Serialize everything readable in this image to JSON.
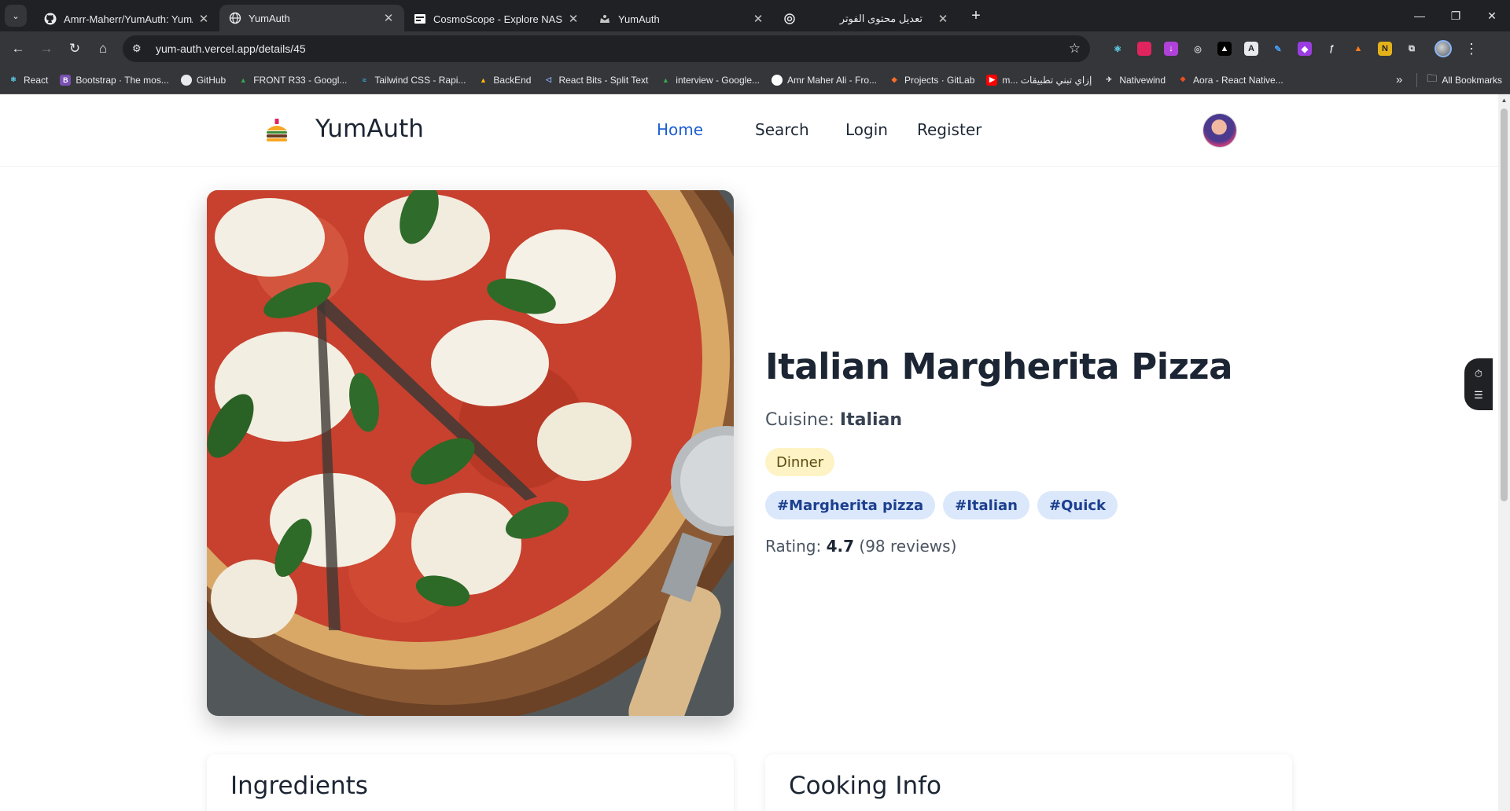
{
  "browser": {
    "tabs": [
      {
        "title": "Amrr-Maherr/YumAuth: YumAuth",
        "icon": "github-icon",
        "active": false
      },
      {
        "title": "YumAuth",
        "icon": "globe-icon",
        "active": true
      },
      {
        "title": "CosmoScope - Explore NASA's",
        "icon": "cosmoscope-icon",
        "active": false
      },
      {
        "title": "YumAuth",
        "icon": "chef-hat-icon",
        "active": false
      },
      {
        "title": "تعديل محتوى الفوتر",
        "icon": "openai-icon",
        "active": false
      }
    ],
    "new_tab": "+",
    "url": "yum-auth.vercel.app/details/45",
    "bookmarks": [
      {
        "label": "React",
        "icon": "react-icon",
        "color": "#61dafb"
      },
      {
        "label": "Bootstrap · The mos...",
        "icon": "bootstrap-icon",
        "color": "#7952b3"
      },
      {
        "label": "GitHub",
        "icon": "github-icon",
        "color": "#e8eaed"
      },
      {
        "label": "FRONT R33 - Googl...",
        "icon": "drive-icon",
        "color": "#34a853"
      },
      {
        "label": "Tailwind CSS - Rapi...",
        "icon": "tailwind-icon",
        "color": "#38bdf8"
      },
      {
        "label": "BackEnd",
        "icon": "drive-icon",
        "color": "#fbbc04"
      },
      {
        "label": "React Bits - Split Text",
        "icon": "reactbits-icon",
        "color": "#5227ff"
      },
      {
        "label": "interview - Google...",
        "icon": "drive-icon",
        "color": "#34a853"
      },
      {
        "label": "Amr Maher Ali - Fro...",
        "icon": "profile-icon",
        "color": "#ffffff"
      },
      {
        "label": "Projects · GitLab",
        "icon": "gitlab-icon",
        "color": "#fc6d26"
      },
      {
        "label": "m... إزاي تبني تطبيقات",
        "icon": "youtube-icon",
        "color": "#ff0000"
      },
      {
        "label": "Nativewind",
        "icon": "nativewind-icon",
        "color": "#e8eaed"
      },
      {
        "label": "Aora - React Native...",
        "icon": "figma-icon",
        "color": "#f24e1e"
      }
    ],
    "bookmarks_more": "»",
    "all_bookmarks": "All Bookmarks"
  },
  "site": {
    "brand": "YumAuth",
    "nav": [
      {
        "label": "Home",
        "active": true
      },
      {
        "label": "Search",
        "active": false
      },
      {
        "label": "Login",
        "active": false
      },
      {
        "label": "Register",
        "active": false
      }
    ]
  },
  "recipe": {
    "title": "Italian Margherita Pizza",
    "cuisine_label": "Cuisine:",
    "cuisine": "Italian",
    "meal_type": "Dinner",
    "tags": [
      "#Margherita pizza",
      "#Italian",
      "#Quick"
    ],
    "rating_label": "Rating:",
    "rating": "4.7",
    "reviews": "(98 reviews)",
    "image_alt": "Italian Margherita Pizza"
  },
  "sections": {
    "ingredients": "Ingredients",
    "cooking_info": "Cooking Info"
  },
  "colors": {
    "accent": "#1d5fd1",
    "tag_bg": "#dbe7fb",
    "meal_badge_bg": "#fdf3c4"
  }
}
